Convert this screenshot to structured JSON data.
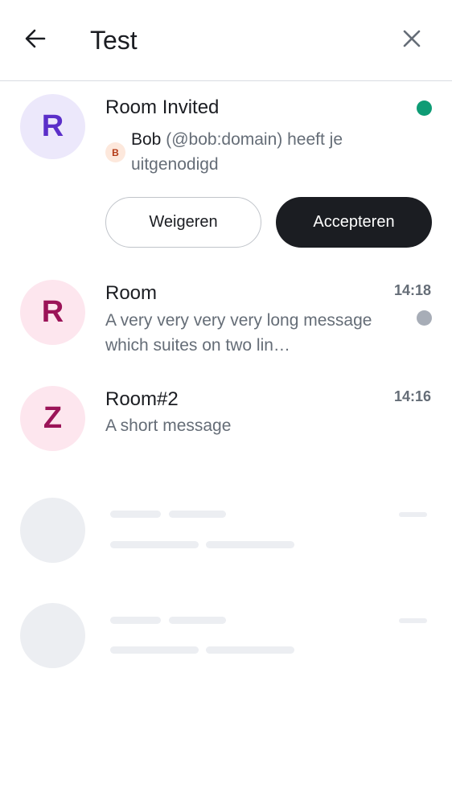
{
  "header": {
    "title": "Test",
    "back_icon": "arrow-left-icon",
    "close_icon": "close-icon"
  },
  "invite": {
    "avatar_letter": "R",
    "room_name": "Room Invited",
    "inviter_avatar_letter": "B",
    "inviter_name": "Bob",
    "inviter_id": "(@bob:domain)",
    "invite_message": "heeft je uitgenodigd",
    "decline_label": "Weigeren",
    "accept_label": "Accepteren",
    "unread_color": "#0e9c75"
  },
  "rooms": [
    {
      "avatar_letter": "R",
      "name": "Room",
      "last_message": "A very very very very long message which suites on two lin…",
      "time": "14:18",
      "unread_color": "#a7adb7"
    },
    {
      "avatar_letter": "Z",
      "name": "Room#2",
      "last_message": "A short message",
      "time": "14:16"
    }
  ],
  "colors": {
    "invite_avatar_bg": "#ece8fb",
    "invite_avatar_fg": "#5b2fc9",
    "room_avatar_bg": "#fde6ee",
    "room_avatar_fg": "#9b1458",
    "skeleton": "#eceef2"
  }
}
